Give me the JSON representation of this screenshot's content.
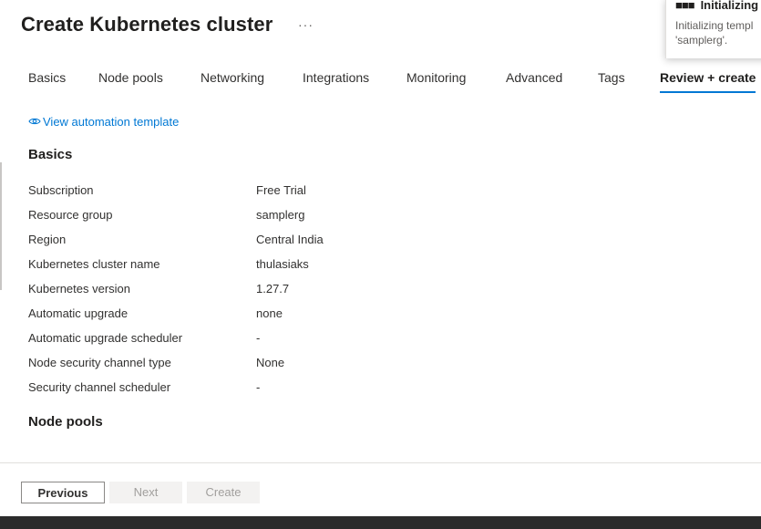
{
  "page": {
    "title": "Create Kubernetes cluster",
    "more_icon": "···"
  },
  "tabs": [
    {
      "label": "Basics"
    },
    {
      "label": "Node pools"
    },
    {
      "label": "Networking"
    },
    {
      "label": "Integrations"
    },
    {
      "label": "Monitoring"
    },
    {
      "label": "Advanced"
    },
    {
      "label": "Tags"
    },
    {
      "label": "Review + create",
      "active": true
    }
  ],
  "automation_link": {
    "label": "View automation template",
    "icon": "eye-icon"
  },
  "sections": {
    "basics": {
      "title": "Basics",
      "rows": [
        {
          "label": "Subscription",
          "value": "Free Trial"
        },
        {
          "label": "Resource group",
          "value": "samplerg"
        },
        {
          "label": "Region",
          "value": "Central India"
        },
        {
          "label": "Kubernetes cluster name",
          "value": "thulasiaks"
        },
        {
          "label": "Kubernetes version",
          "value": "1.27.7"
        },
        {
          "label": "Automatic upgrade",
          "value": "none"
        },
        {
          "label": "Automatic upgrade scheduler",
          "value": "-"
        },
        {
          "label": "Node security channel type",
          "value": "None"
        },
        {
          "label": "Security channel scheduler",
          "value": "-"
        }
      ]
    },
    "node_pools": {
      "title": "Node pools"
    }
  },
  "footer": {
    "previous_label": "Previous",
    "next_label": "Next",
    "create_label": "Create"
  },
  "notification": {
    "icon": "progress-dots-icon",
    "title": "Initializing d",
    "body_line1": "Initializing templ",
    "body_line2": "'samplerg'."
  },
  "colors": {
    "accent": "#0078d4",
    "disabled_bg": "#f3f2f1",
    "disabled_text": "#a19f9d"
  }
}
